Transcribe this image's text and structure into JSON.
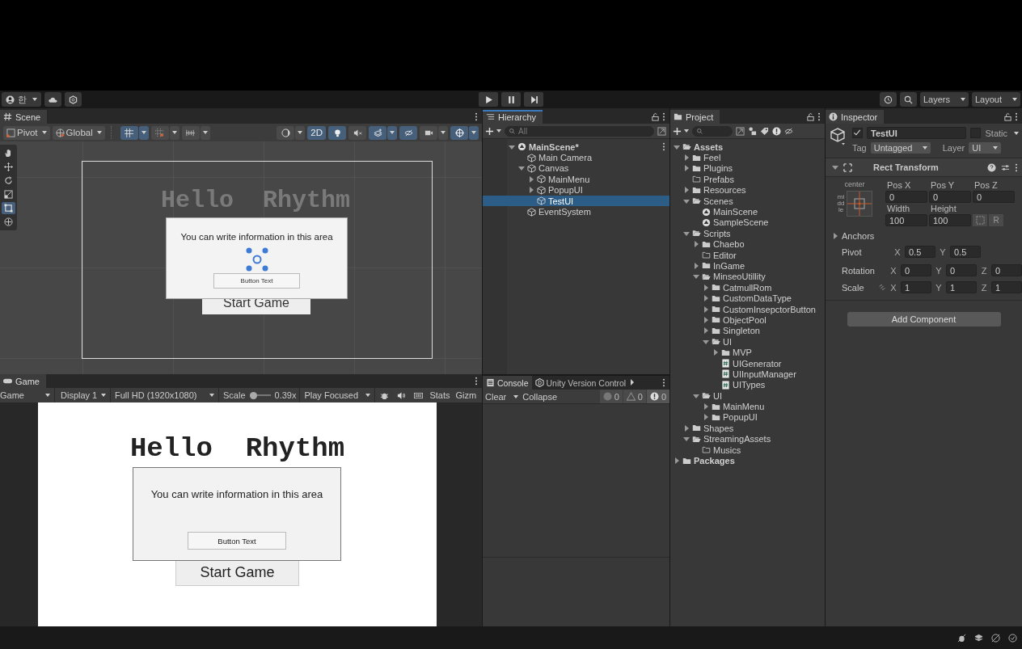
{
  "toolbar": {
    "account": "한",
    "layers": "Layers",
    "layout": "Layout"
  },
  "scene": {
    "tab": "Scene",
    "pivot": "Pivot",
    "handle_space": "Global",
    "snap_tools": [
      {
        "kind": "grid",
        "on": true
      },
      {
        "kind": "snap",
        "on": false
      },
      {
        "kind": "increment",
        "on": false
      }
    ],
    "view_toggles": [
      {
        "kind": "shading",
        "on": false
      },
      {
        "kind": "dimension",
        "label": "2D",
        "on": true
      },
      {
        "kind": "lighting",
        "on": true
      },
      {
        "kind": "audio",
        "on": false
      },
      {
        "kind": "effects",
        "on": true
      },
      {
        "kind": "visibility",
        "on": true
      },
      {
        "kind": "camera",
        "on": false
      },
      {
        "kind": "gizmos",
        "on": true
      }
    ],
    "tools": [
      {
        "kind": "hand",
        "selected": false
      },
      {
        "kind": "move",
        "selected": false
      },
      {
        "kind": "rotate",
        "selected": false
      },
      {
        "kind": "scale",
        "selected": false
      },
      {
        "kind": "rect",
        "selected": true
      },
      {
        "kind": "transform",
        "selected": false
      }
    ],
    "ui": {
      "title": "Hello  Rhythm",
      "start_button": "Start Game",
      "popup_text": "You can write information in this area",
      "popup_button": "Button Text"
    }
  },
  "game": {
    "tab": "Game",
    "view": "Game",
    "display": "Display 1",
    "resolution": "Full HD (1920x1080)",
    "scale": {
      "label": "Scale",
      "level": 0.12,
      "reading": "0.39x"
    },
    "play_mode": "Play Focused",
    "stats": "Stats",
    "gizmos": "Gizm",
    "ui": {
      "title": "Hello  Rhythm",
      "start_button": "Start Game",
      "popup_text": "You can write information in this area",
      "popup_button": "Button Text"
    }
  },
  "hierarchy": {
    "tab": "Hierarchy",
    "search_placeholder": "All",
    "items": [
      {
        "name": "MainScene*",
        "kind": "scene",
        "expanded": true,
        "selected": false,
        "children": [
          {
            "name": "Main Camera",
            "kind": "object",
            "selected": false
          },
          {
            "name": "Canvas",
            "kind": "object",
            "expanded": true,
            "selected": false,
            "children": [
              {
                "name": "MainMenu",
                "kind": "object",
                "expanded": false,
                "selected": false
              },
              {
                "name": "PopupUI",
                "kind": "object",
                "expanded": false,
                "selected": false
              },
              {
                "name": "TestUI",
                "kind": "object",
                "selected": true
              }
            ]
          },
          {
            "name": "EventSystem",
            "kind": "object",
            "selected": false
          }
        ]
      }
    ]
  },
  "console": {
    "tabs": [
      {
        "label": "Console",
        "kind": "console",
        "selected": true
      },
      {
        "label": "Unity Version Control",
        "kind": "vcs",
        "selected": false
      }
    ],
    "clear": "Clear",
    "collapse": "Collapse",
    "counts": [
      {
        "kind": "info",
        "count": "0"
      },
      {
        "kind": "warning",
        "count": "0"
      },
      {
        "kind": "error",
        "count": "0"
      }
    ]
  },
  "project": {
    "tab": "Project",
    "tree": [
      {
        "name": "Assets",
        "kind": "folder",
        "expanded": true,
        "children": [
          {
            "name": "Feel",
            "kind": "folder",
            "expanded": false
          },
          {
            "name": "Plugins",
            "kind": "folder",
            "expanded": false
          },
          {
            "name": "Prefabs",
            "kind": "empty_folder"
          },
          {
            "name": "Resources",
            "kind": "folder",
            "expanded": false
          },
          {
            "name": "Scenes",
            "kind": "folder",
            "expanded": true,
            "children": [
              {
                "name": "MainScene",
                "kind": "scene"
              },
              {
                "name": "SampleScene",
                "kind": "scene"
              }
            ]
          },
          {
            "name": "Scripts",
            "kind": "folder",
            "expanded": true,
            "children": [
              {
                "name": "Chaebo",
                "kind": "folder",
                "expanded": false
              },
              {
                "name": "Editor",
                "kind": "empty_folder"
              },
              {
                "name": "InGame",
                "kind": "folder",
                "expanded": false
              },
              {
                "name": "MinseoUtillity",
                "kind": "folder",
                "expanded": true,
                "children": [
                  {
                    "name": "CatmullRom",
                    "kind": "folder",
                    "expanded": false
                  },
                  {
                    "name": "CustomDataType",
                    "kind": "folder",
                    "expanded": false
                  },
                  {
                    "name": "CustomInsepctorButton",
                    "kind": "folder",
                    "expanded": false
                  },
                  {
                    "name": "ObjectPool",
                    "kind": "folder",
                    "expanded": false
                  },
                  {
                    "name": "Singleton",
                    "kind": "folder",
                    "expanded": false
                  },
                  {
                    "name": "UI",
                    "kind": "folder",
                    "expanded": true,
                    "children": [
                      {
                        "name": "MVP",
                        "kind": "folder",
                        "expanded": false
                      },
                      {
                        "name": "UIGenerator",
                        "kind": "script"
                      },
                      {
                        "name": "UIInputManager",
                        "kind": "script"
                      },
                      {
                        "name": "UITypes",
                        "kind": "script"
                      }
                    ]
                  }
                ]
              },
              {
                "name": "UI",
                "kind": "folder",
                "expanded": true,
                "children": [
                  {
                    "name": "MainMenu",
                    "kind": "folder",
                    "expanded": false
                  },
                  {
                    "name": "PopupUI",
                    "kind": "folder",
                    "expanded": false
                  }
                ]
              }
            ]
          },
          {
            "name": "Shapes",
            "kind": "folder",
            "expanded": false
          },
          {
            "name": "StreamingAssets",
            "kind": "folder",
            "expanded": true,
            "children": [
              {
                "name": "Musics",
                "kind": "empty_folder"
              }
            ]
          }
        ]
      },
      {
        "name": "Packages",
        "kind": "folder",
        "expanded": false
      }
    ]
  },
  "inspector": {
    "tab": "Inspector",
    "object": {
      "active": true,
      "name": "TestUI",
      "static_label": "Static",
      "static": false,
      "tag_label": "Tag",
      "tag": "Untagged",
      "layer_label": "Layer",
      "layer": "UI"
    },
    "component": {
      "title": "Rect Transform",
      "expanded": true,
      "anchor_h": "center",
      "anchor_v": "middle",
      "position": [
        {
          "label": "Pos X",
          "value": "0"
        },
        {
          "label": "Pos Y",
          "value": "0"
        },
        {
          "label": "Pos Z",
          "value": "0"
        }
      ],
      "size": [
        {
          "label": "Width",
          "value": "100"
        },
        {
          "label": "Height",
          "value": "100"
        }
      ],
      "raw_button": "R",
      "anchors": "Anchors",
      "anchors_expanded": false,
      "pivot": {
        "label": "Pivot",
        "axes": [
          {
            "axis": "X",
            "value": "0.5"
          },
          {
            "axis": "Y",
            "value": "0.5"
          }
        ]
      },
      "rotation": {
        "label": "Rotation",
        "axes": [
          {
            "axis": "X",
            "value": "0"
          },
          {
            "axis": "Y",
            "value": "0"
          },
          {
            "axis": "Z",
            "value": "0"
          }
        ]
      },
      "scale": {
        "label": "Scale",
        "axes": [
          {
            "axis": "X",
            "value": "1"
          },
          {
            "axis": "Y",
            "value": "1"
          },
          {
            "axis": "Z",
            "value": "1"
          }
        ]
      }
    },
    "add_component": "Add Component"
  }
}
